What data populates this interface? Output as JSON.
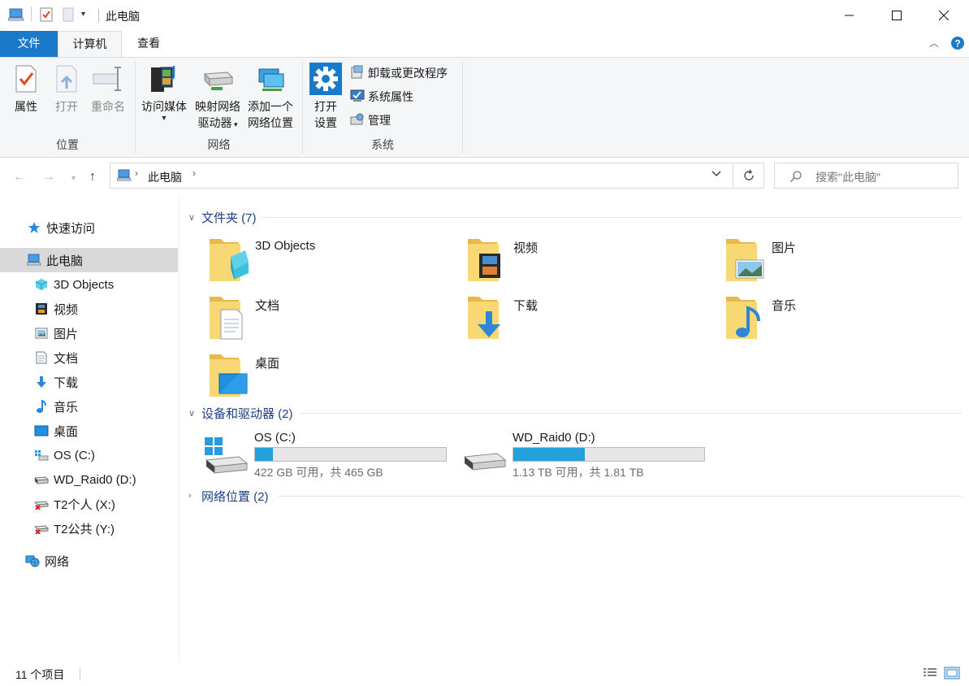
{
  "window": {
    "title": "此电脑"
  },
  "ribbon": {
    "tabs": [
      "文件",
      "计算机",
      "查看"
    ],
    "groups": {
      "location": {
        "label": "位置",
        "buttons": [
          "属性",
          "打开",
          "重命名"
        ]
      },
      "network": {
        "label": "网络",
        "access_media": "访问媒体",
        "map_drive_line1": "映射网络",
        "map_drive_line2": "驱动器",
        "add_location_line1": "添加一个",
        "add_location_line2": "网络位置"
      },
      "system": {
        "label": "系统",
        "open_settings_line1": "打开",
        "open_settings_line2": "设置",
        "uninstall": "卸载或更改程序",
        "system_properties": "系统属性",
        "manage": "管理"
      }
    }
  },
  "address": {
    "path": "此电脑",
    "search_placeholder": "搜索\"此电脑\""
  },
  "sidebar": {
    "quick_access": "快速访问",
    "this_pc": "此电脑",
    "items": [
      "3D Objects",
      "视频",
      "图片",
      "文档",
      "下载",
      "音乐",
      "桌面",
      "OS (C:)",
      "WD_Raid0 (D:)",
      "T2个人 (X:)",
      "T2公共 (Y:)"
    ],
    "network": "网络"
  },
  "content": {
    "folders_header": "文件夹 (7)",
    "folders": [
      "3D Objects",
      "视频",
      "图片",
      "文档",
      "下载",
      "音乐",
      "桌面"
    ],
    "drives_header": "设备和驱动器 (2)",
    "drives": [
      {
        "name": "OS (C:)",
        "usage": "422 GB 可用，共 465 GB",
        "used_fraction": 0.093
      },
      {
        "name": "WD_Raid0 (D:)",
        "usage": "1.13 TB 可用，共 1.81 TB",
        "used_fraction": 0.376
      }
    ],
    "network_header": "网络位置 (2)"
  },
  "status": {
    "count": "11 个项目"
  },
  "colors": {
    "accent": "#1979ca",
    "group_header": "#1e3f86",
    "bar_fill": "#26a0da",
    "folder": "#f8d775"
  }
}
